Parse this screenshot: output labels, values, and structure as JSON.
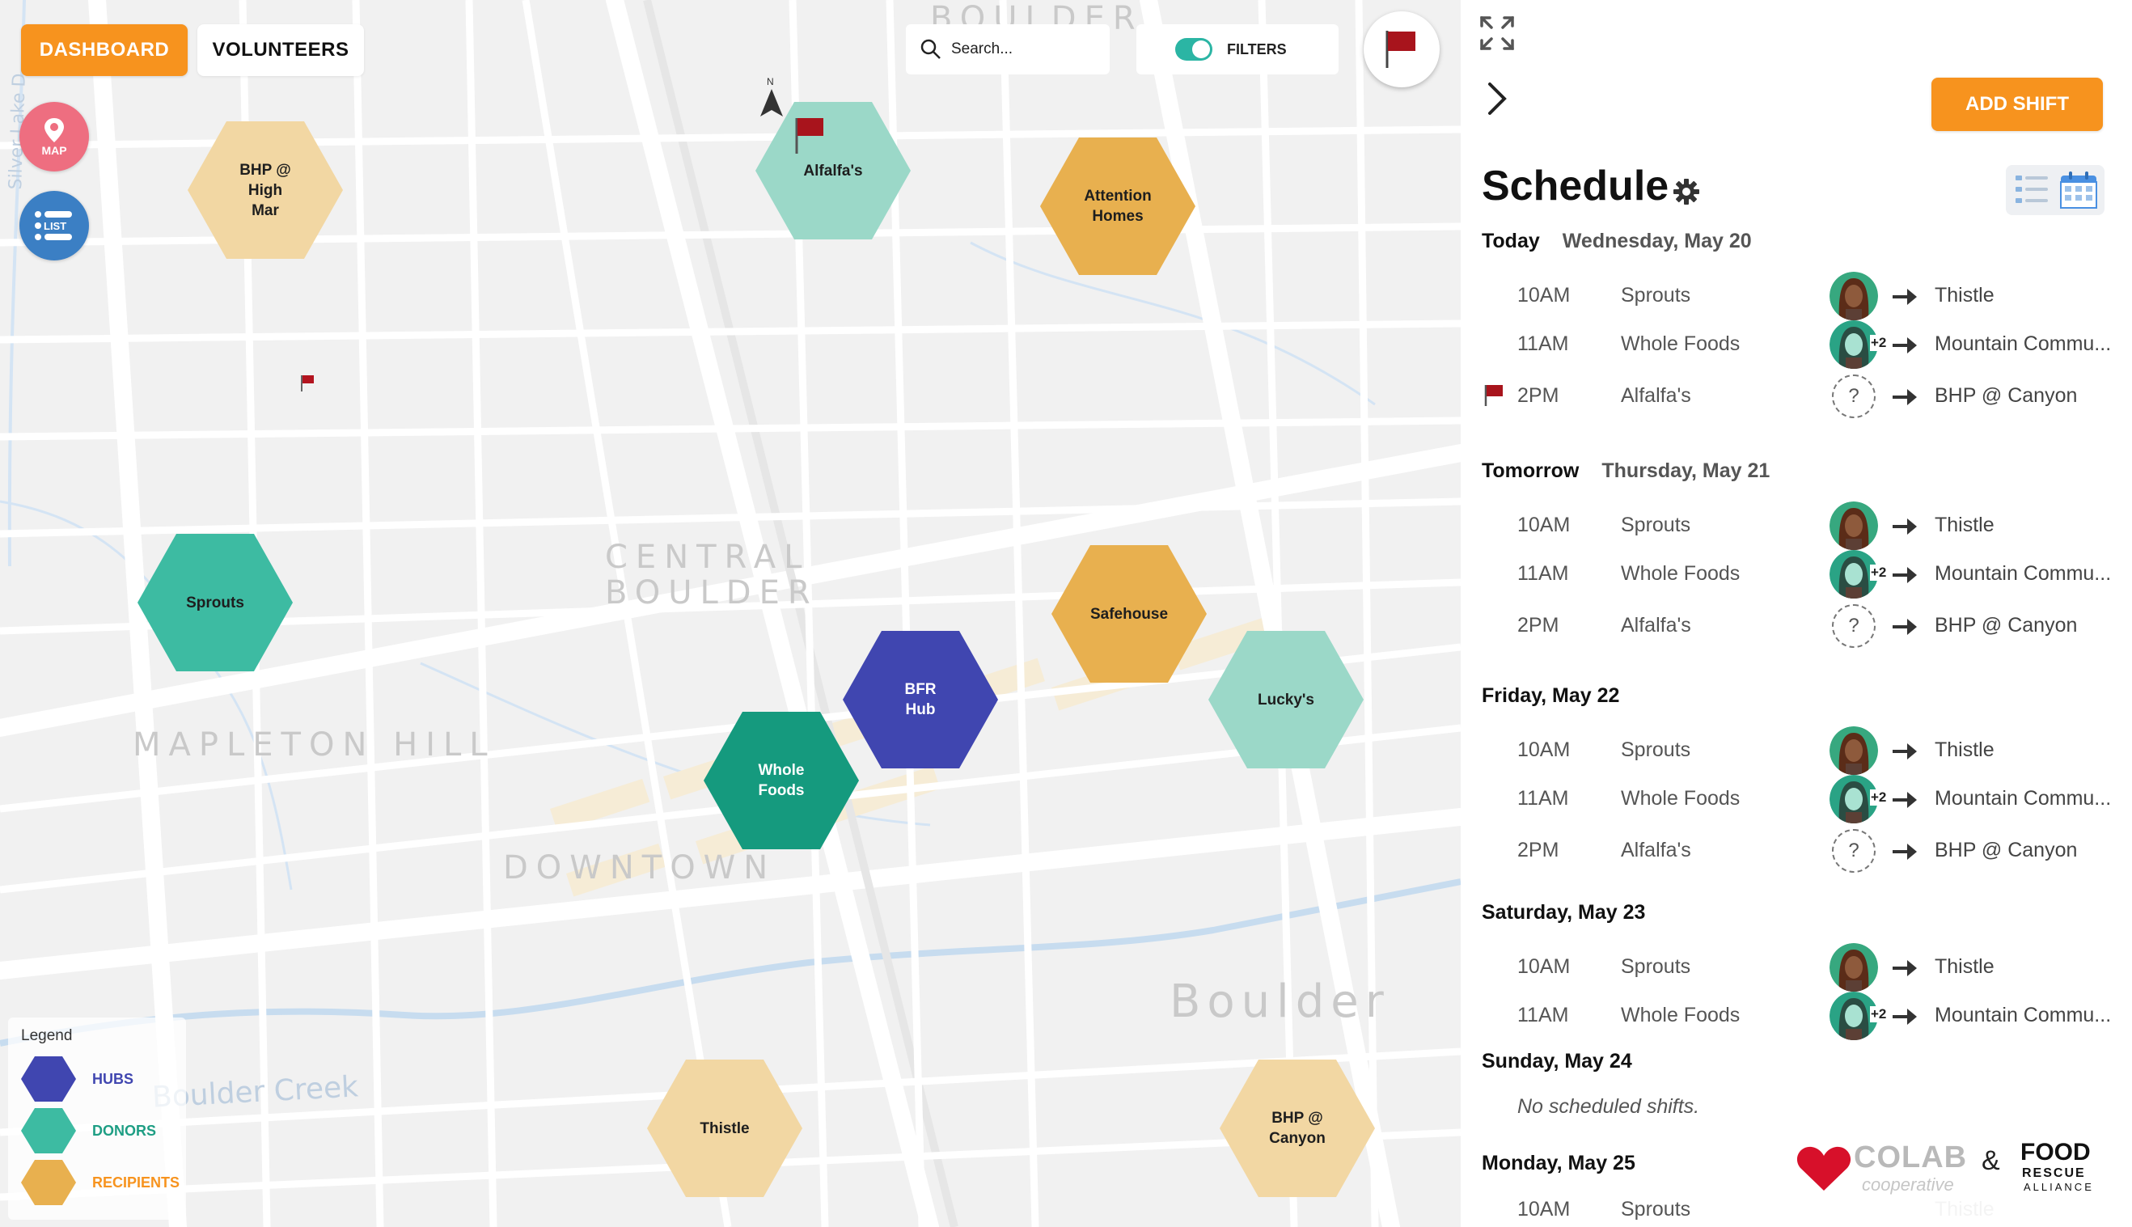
{
  "app": {
    "accent_color": "#f7931e"
  },
  "top_nav": {
    "dashboard_label": "DASHBOARD",
    "volunteers_label": "VOLUNTEERS"
  },
  "search": {
    "placeholder": "Search..."
  },
  "filters": {
    "label": "FILTERS",
    "enabled": true
  },
  "map_controls": {
    "map_label": "MAP",
    "list_label": "LIST",
    "compass_label": "N"
  },
  "map": {
    "area_labels": [
      "BOULDER",
      "CENTRAL",
      "BOULDER",
      "MAPLETON HILL",
      "DOWNTOWN",
      "Boulder",
      "Boulder Creek",
      "Silver Lake D"
    ],
    "locations": [
      {
        "name": "BHP @ High Mar",
        "line1": "BHP @",
        "line2": "High Mar",
        "type": "recipient"
      },
      {
        "name": "Alfalfa's",
        "line1": "Alfalfa's",
        "line2": "",
        "type": "donor",
        "flagged": true
      },
      {
        "name": "Attention Homes",
        "line1": "Attention",
        "line2": "Homes",
        "type": "recipient"
      },
      {
        "name": "Sprouts",
        "line1": "Sprouts",
        "line2": "",
        "type": "donor"
      },
      {
        "name": "Safehouse",
        "line1": "Safehouse",
        "line2": "",
        "type": "recipient"
      },
      {
        "name": "BFR Hub",
        "line1": "BFR Hub",
        "line2": "",
        "type": "hub"
      },
      {
        "name": "Lucky's",
        "line1": "Lucky's",
        "line2": "",
        "type": "donor"
      },
      {
        "name": "Whole Foods",
        "line1": "Whole",
        "line2": "Foods",
        "type": "donor"
      },
      {
        "name": "Thistle",
        "line1": "Thistle",
        "line2": "",
        "type": "recipient"
      },
      {
        "name": "BHP @ Canyon",
        "line1": "BHP @",
        "line2": "Canyon",
        "type": "recipient"
      }
    ]
  },
  "legend": {
    "title": "Legend",
    "items": [
      {
        "label": "HUBS",
        "color": "#4046b0"
      },
      {
        "label": "DONORS",
        "color": "#3dbba2"
      },
      {
        "label": "RECIPIENTS",
        "color": "#e8b04f"
      }
    ]
  },
  "panel": {
    "add_shift_label": "ADD SHIFT",
    "title": "Schedule",
    "days": [
      {
        "label": "Today",
        "date": "Wednesday, May 20",
        "shifts": [
          {
            "time": "10AM",
            "donor": "Sprouts",
            "volunteer": "avatar-a",
            "extra": "",
            "recipient": "Thistle",
            "flagged": false
          },
          {
            "time": "11AM",
            "donor": "Whole Foods",
            "volunteer": "avatar-b",
            "extra": "+2",
            "recipient": "Mountain Commu...",
            "flagged": false
          },
          {
            "time": "2PM",
            "donor": "Alfalfa's",
            "volunteer": "unknown",
            "extra": "",
            "recipient": "BHP @ Canyon",
            "flagged": true
          }
        ]
      },
      {
        "label": "Tomorrow",
        "date": "Thursday, May 21",
        "shifts": [
          {
            "time": "10AM",
            "donor": "Sprouts",
            "volunteer": "avatar-a",
            "extra": "",
            "recipient": "Thistle",
            "flagged": false
          },
          {
            "time": "11AM",
            "donor": "Whole Foods",
            "volunteer": "avatar-b",
            "extra": "+2",
            "recipient": "Mountain Commu...",
            "flagged": false
          },
          {
            "time": "2PM",
            "donor": "Alfalfa's",
            "volunteer": "unknown",
            "extra": "",
            "recipient": "BHP @ Canyon",
            "flagged": false
          }
        ]
      },
      {
        "label": "Friday, May 22",
        "date": "",
        "shifts": [
          {
            "time": "10AM",
            "donor": "Sprouts",
            "volunteer": "avatar-a",
            "extra": "",
            "recipient": "Thistle",
            "flagged": false
          },
          {
            "time": "11AM",
            "donor": "Whole Foods",
            "volunteer": "avatar-b",
            "extra": "+2",
            "recipient": "Mountain Commu...",
            "flagged": false
          },
          {
            "time": "2PM",
            "donor": "Alfalfa's",
            "volunteer": "unknown",
            "extra": "",
            "recipient": "BHP @ Canyon",
            "flagged": false
          }
        ]
      },
      {
        "label": "Saturday, May 23",
        "date": "",
        "shifts": [
          {
            "time": "10AM",
            "donor": "Sprouts",
            "volunteer": "avatar-a",
            "extra": "",
            "recipient": "Thistle",
            "flagged": false
          },
          {
            "time": "11AM",
            "donor": "Whole Foods",
            "volunteer": "avatar-b",
            "extra": "+2",
            "recipient": "Mountain Commu...",
            "flagged": false
          }
        ]
      },
      {
        "label": "Sunday, May 24",
        "date": "",
        "empty_text": "No scheduled shifts.",
        "shifts": []
      },
      {
        "label": "Monday, May 25",
        "date": "",
        "shifts": [
          {
            "time": "10AM",
            "donor": "Sprouts",
            "volunteer": "",
            "extra": "",
            "recipient": "Thistle",
            "flagged": false
          }
        ]
      }
    ]
  },
  "footer": {
    "colab_name": "COLAB",
    "colab_sub": "cooperative",
    "ampersand": "&",
    "frc_line1": "FOOD",
    "frc_line2": "RESCUE",
    "frc_line3": "ALLIANCE"
  }
}
